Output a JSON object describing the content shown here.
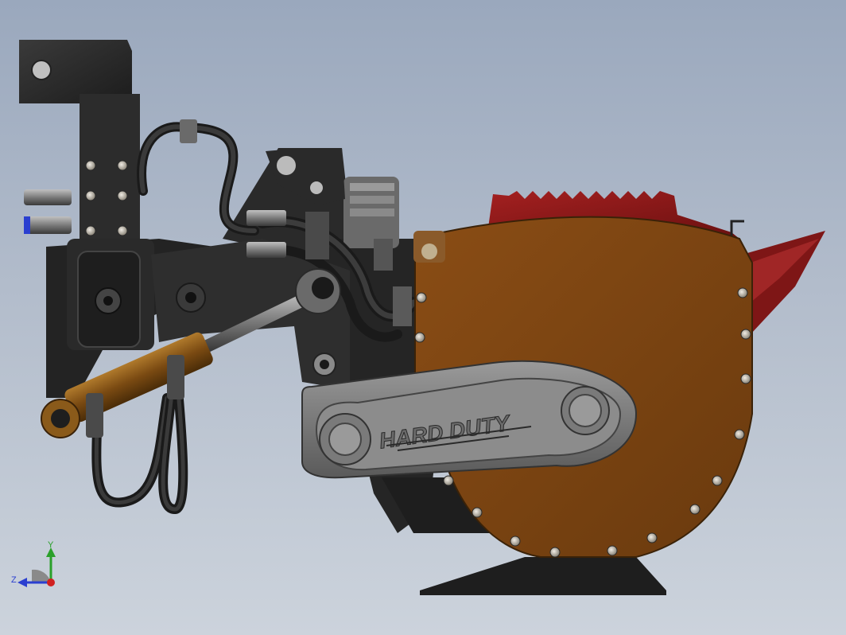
{
  "viewport": {
    "background_top": "#9aa8bd",
    "background_bottom": "#ccd3dc"
  },
  "model": {
    "logo_text": "HARD DUTY",
    "colors": {
      "frame": "#262626",
      "rotor_housing": "#7a4412",
      "guard_red": "#8e1a1a",
      "cylinder": "#8a5a1a",
      "belt_cover": "#7e7e7e",
      "bolts": "#c8c0b0"
    }
  },
  "triad": {
    "y_label": "Y",
    "z_label": "Z",
    "y_color": "#2aa02a",
    "z_color": "#2a3fd0",
    "x_color": "#d02020"
  }
}
